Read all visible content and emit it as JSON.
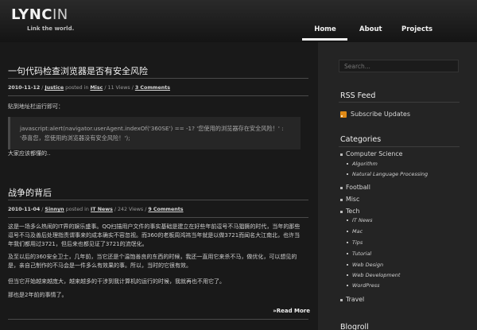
{
  "header": {
    "logo_main": "LYNC",
    "logo_suffix": "IN",
    "tagline": "Link the world.",
    "nav": [
      {
        "label": "Home"
      },
      {
        "label": "About"
      },
      {
        "label": "Projects"
      }
    ]
  },
  "posts": [
    {
      "title": "一句代码检查浏览器是否有安全风险",
      "date": "2010-11-12",
      "author": "Justice",
      "posted_in": "posted in",
      "category": "Misc",
      "views": "11 Views",
      "comments": "3 Comments",
      "intro": "贴到地址栏运行即可：",
      "code": "javascript:alert(navigator.userAgent.indexOf('360SE') == -1? '您使用的浏览器存在安全风险！' : '恭喜您，您使用的浏览器没有安全风险！');",
      "outro": "大家应该都懂的.."
    },
    {
      "title": "战争的背后",
      "date": "2010-11-04",
      "author": "Sinnyn",
      "posted_in": "posted in",
      "category": "IT News",
      "views": "242 Views",
      "comments": "9 Comments",
      "paragraphs": [
        "这是一场多么热闹的IT界的娱乐盛事。QQ扫描用户文件的事实基础是建立在好些年前逗号不马猖獗的时代，当年的那些逗号不马及善后处理指责谓事来的成本确实不容忽视。而360的老板周鸿祎当年就是以做3721而闻名大江南北，也许当年我们都用过3721，但后来也都见证了3721的流氓化。",
        "及至以后的360安全卫士，几年前，当它还是个温饱善良的东西的时候，我还一直用它来杀不马，做优化，可以想见的是，亲自己制作的不马会是一件多么有效果的事。所以，当时的它很有效。",
        "但当它开始越来越庞大，越来越多的干涉到我计算机的运行的时候，我就再也不用它了。",
        "那也是2年前的事情了。"
      ],
      "read_more": "»Read More"
    }
  ],
  "sidebar": {
    "search_placeholder": "Search...",
    "rss_heading": "RSS Feed",
    "rss_link": "Subscribe Updates",
    "categories_heading": "Categories",
    "categories": {
      "computer_science": "Computer Science",
      "cs_sub": [
        "Algorithm",
        "Natural Language Processing"
      ],
      "football": "Football",
      "misc": "Misc",
      "tech": "Tech",
      "tech_sub": [
        "IT News",
        "Mac",
        "Tips",
        "Tutorial",
        "Web Design",
        "Web Development",
        "WordPress"
      ],
      "travel": "Travel"
    },
    "blogroll_heading": "Blogroll"
  },
  "colors": {
    "background": "#191919",
    "sidebar": "#242424",
    "rss_orange": "#e08a16"
  }
}
